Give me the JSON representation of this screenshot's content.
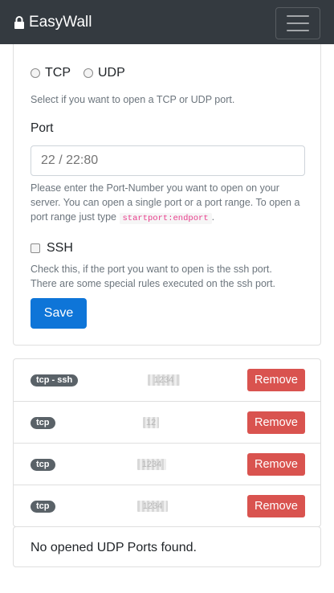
{
  "navbar": {
    "brand": "EasyWall"
  },
  "form": {
    "protocol_options": [
      "TCP",
      "UDP"
    ],
    "protocol_help": "Select if you want to open a TCP or UDP port.",
    "port_label": "Port",
    "port_placeholder": "22 / 22:80",
    "port_help": "Please enter the Port-Number you want to open on your server. You can open a single port or a port range. To open a port range just type",
    "port_help_code": "startport:endport",
    "port_help_end": ".",
    "ssh_label": "SSH",
    "ssh_help": "Check this, if the port you want to open is the ssh port. There are some special rules executed on the ssh port.",
    "save_label": "Save"
  },
  "tcp_ports": [
    {
      "badge": "tcp - ssh",
      "port": "1234",
      "remove_label": "Remove"
    },
    {
      "badge": "tcp",
      "port": "12",
      "remove_label": "Remove"
    },
    {
      "badge": "tcp",
      "port": "1234",
      "remove_label": "Remove"
    },
    {
      "badge": "tcp",
      "port": "1234",
      "remove_label": "Remove"
    }
  ],
  "udp_empty_text": "No opened UDP Ports found.",
  "colors": {
    "navbar": "#343a40",
    "primary": "#0e75d8",
    "danger": "#d9534f",
    "badge": "#5a6268",
    "code": "#e83e8c"
  }
}
